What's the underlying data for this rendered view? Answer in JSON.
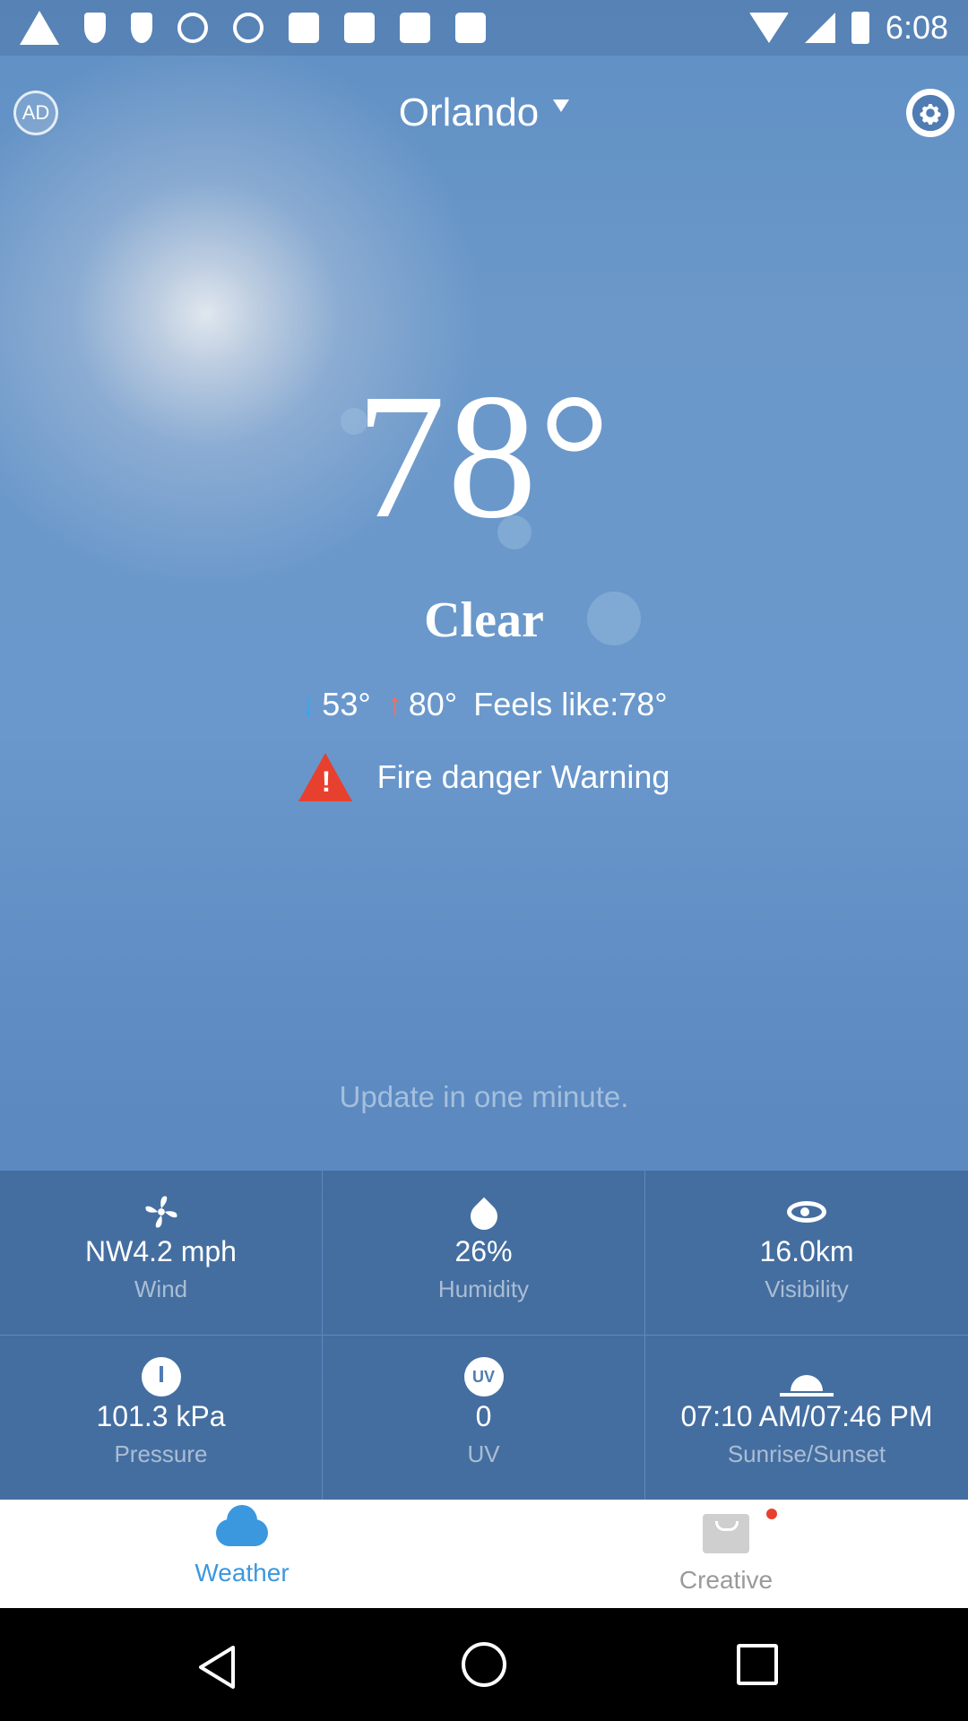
{
  "status_bar": {
    "time": "6:08"
  },
  "header": {
    "ad_label": "AD",
    "city": "Orlando"
  },
  "current": {
    "temperature": "78°",
    "condition": "Clear",
    "low": "53°",
    "high": "80°",
    "feels_like": "Feels like:78°",
    "warning": "Fire danger Warning",
    "update_note": "Update in one minute."
  },
  "details": [
    {
      "value": "NW4.2 mph",
      "label": "Wind",
      "icon": "fan-icon"
    },
    {
      "value": "26%",
      "label": "Humidity",
      "icon": "droplet-icon"
    },
    {
      "value": "16.0km",
      "label": "Visibility",
      "icon": "eye-icon"
    },
    {
      "value": "101.3 kPa",
      "label": "Pressure",
      "icon": "gauge-icon"
    },
    {
      "value": "0",
      "label": "UV",
      "icon": "uv-icon"
    },
    {
      "value": "07:10 AM/07:46 PM",
      "label": "Sunrise/Sunset",
      "icon": "sunrise-icon"
    }
  ],
  "tabs": [
    {
      "label": "Weather",
      "active": true,
      "icon": "cloud-icon"
    },
    {
      "label": "Creative",
      "active": false,
      "icon": "bag-icon",
      "badge": true
    }
  ],
  "colors": {
    "accent": "#3b98de",
    "warning": "#e8402e",
    "low_arrow": "#3aa6ef",
    "high_arrow": "#f07060",
    "inactive_tab": "#9a9a9a"
  }
}
